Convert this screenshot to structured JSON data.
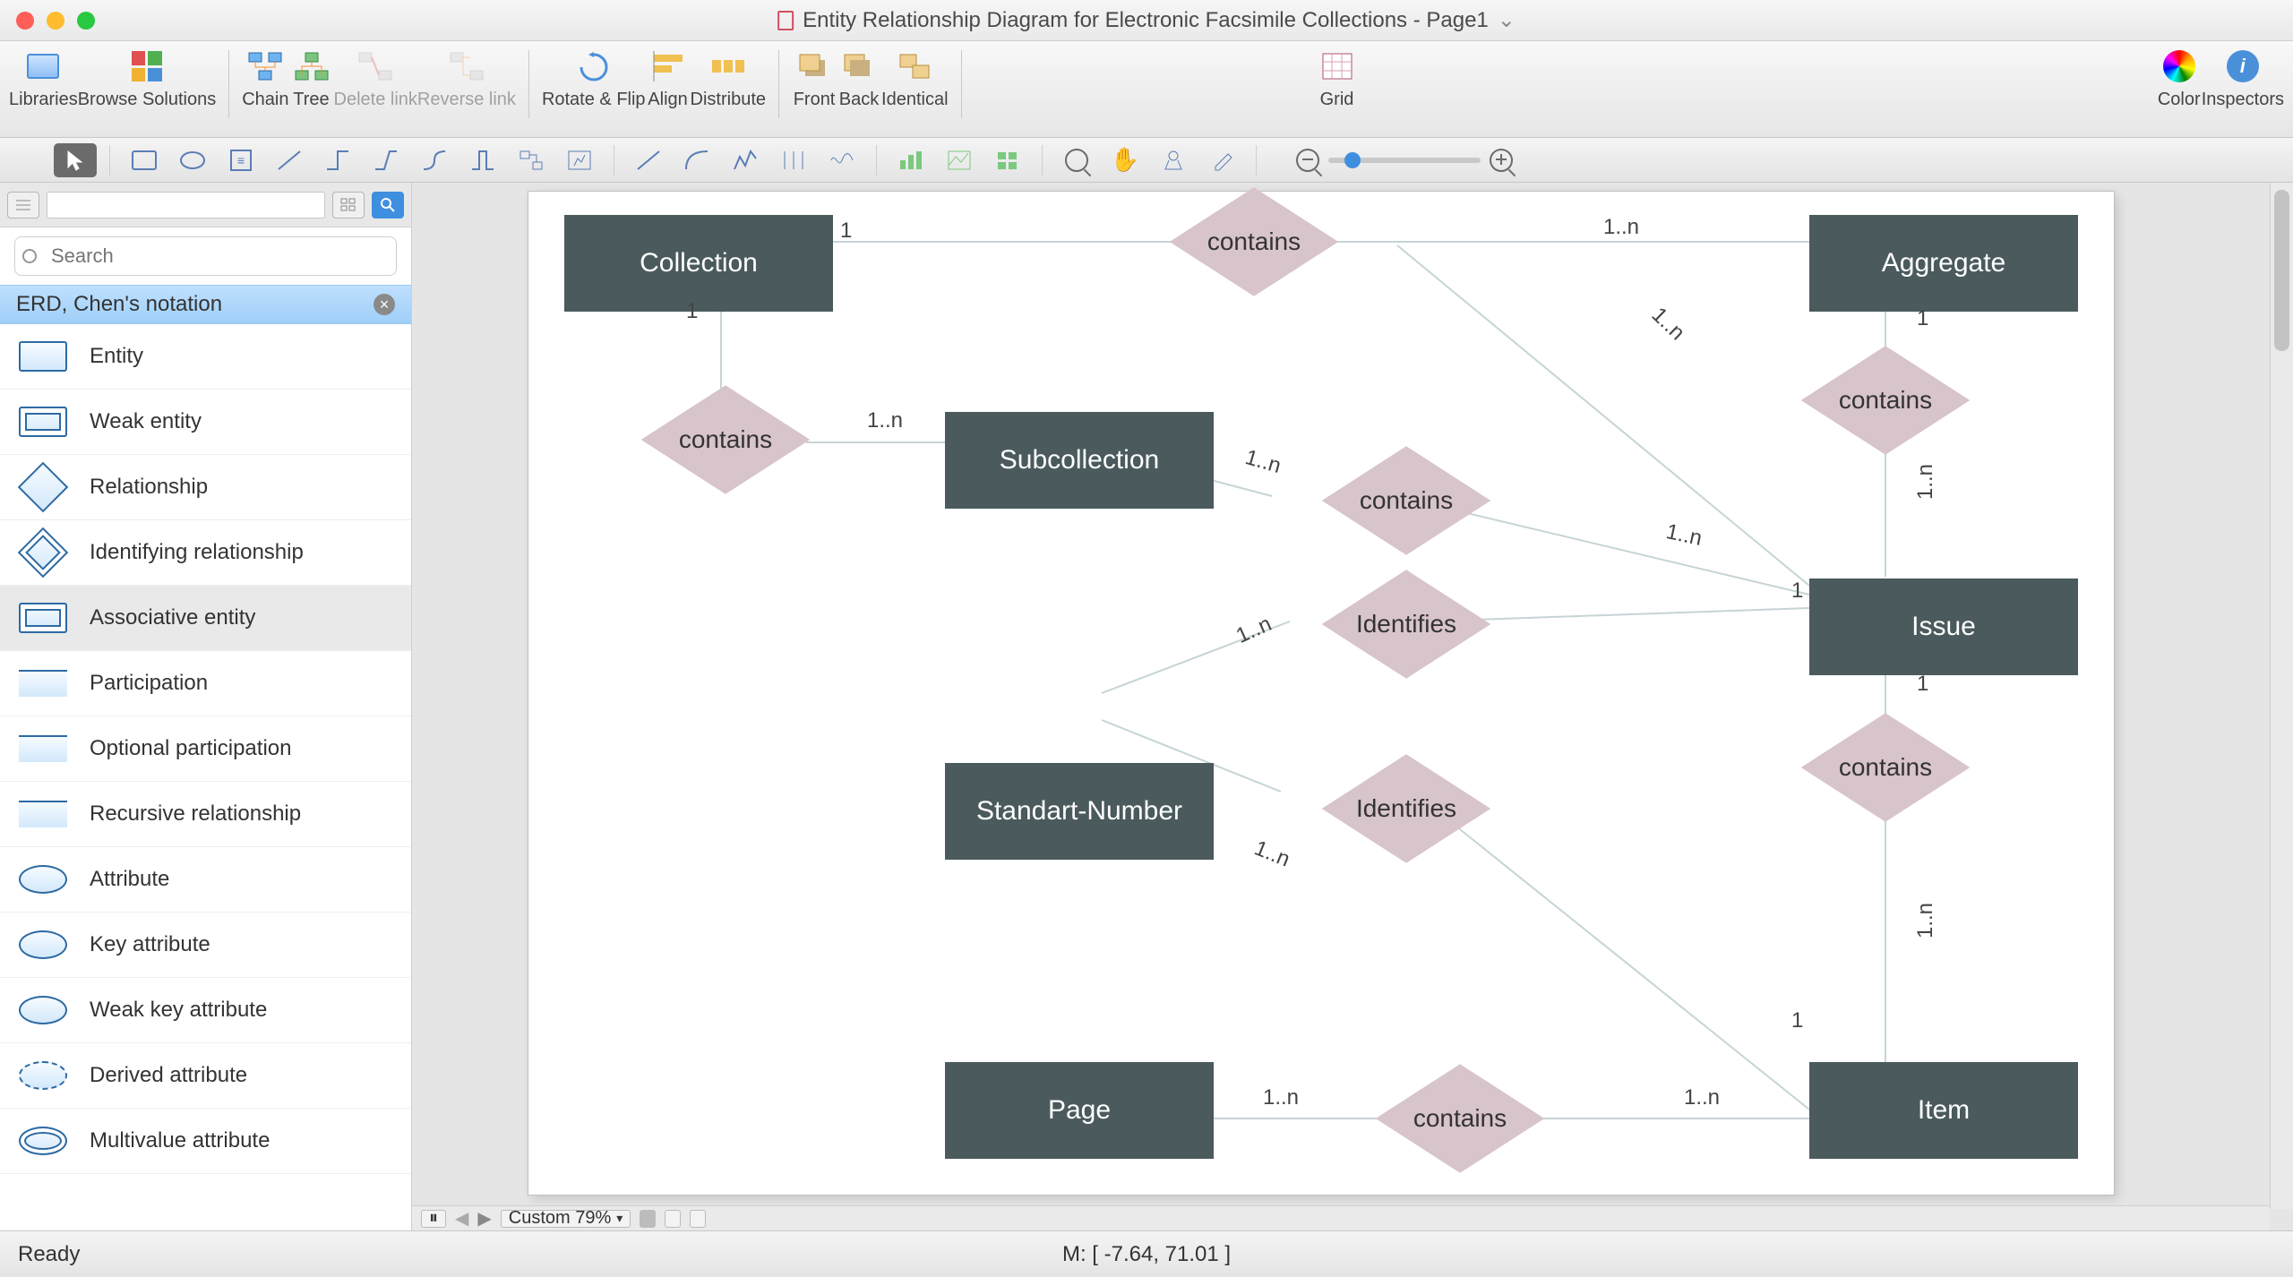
{
  "window": {
    "title": "Entity Relationship Diagram for Electronic Facsimile Collections - Page1"
  },
  "toolbar": {
    "libraries": "Libraries",
    "browse": "Browse Solutions",
    "chain": "Chain",
    "tree": "Tree",
    "delete_link": "Delete link",
    "reverse_link": "Reverse link",
    "rotate_flip": "Rotate & Flip",
    "align": "Align",
    "distribute": "Distribute",
    "front": "Front",
    "back": "Back",
    "identical": "Identical",
    "grid": "Grid",
    "color": "Color",
    "inspectors": "Inspectors"
  },
  "sidebar": {
    "search_placeholder": "Search",
    "category": "ERD, Chen's notation",
    "items": [
      "Entity",
      "Weak entity",
      "Relationship",
      "Identifying relationship",
      "Associative entity",
      "Participation",
      "Optional participation",
      "Recursive relationship",
      "Attribute",
      "Key attribute",
      "Weak key attribute",
      "Derived attribute",
      "Multivalue attribute"
    ],
    "selected_index": 4
  },
  "diagram": {
    "entities": {
      "collection": "Collection",
      "aggregate": "Aggregate",
      "subcollection": "Subcollection",
      "issue": "Issue",
      "standart_number": "Standart-Number",
      "page": "Page",
      "item": "Item"
    },
    "relationships": {
      "contains": "contains",
      "identifies": "Identifies"
    },
    "cardinalities": {
      "one": "1",
      "one_n": "1..n"
    }
  },
  "footer": {
    "zoom_label": "Custom 79%",
    "status": "Ready",
    "mouse": "M: [ -7.64, 71.01 ]"
  }
}
